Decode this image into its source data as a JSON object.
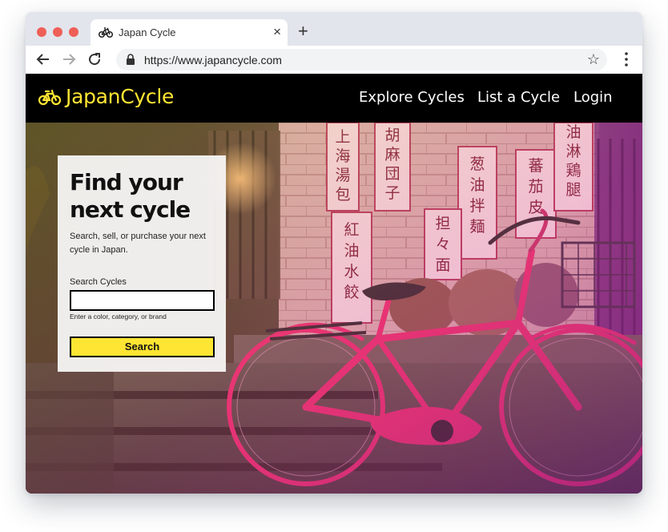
{
  "browser": {
    "tab_title": "Japan Cycle",
    "tab_close": "×",
    "new_tab": "+",
    "url": "https://www.japancycle.com",
    "bookmark": "☆"
  },
  "site": {
    "brand": "JapanCycle",
    "nav": [
      "Explore Cycles",
      "List a Cycle",
      "Login"
    ]
  },
  "hero": {
    "signs": [
      "上海湯包",
      "胡麻団子",
      "葱油拌麺",
      "蕃茄皮",
      "油淋鶏腿",
      "紅油水餃",
      "担々面"
    ]
  },
  "card": {
    "title_line1": "Find your",
    "title_line2": "next cycle",
    "description": "Search, sell, or purchase your next cycle in Japan.",
    "search_label": "Search Cycles",
    "search_value": "",
    "search_hint": "Enter a color, category, or brand",
    "search_button": "Search"
  },
  "colors": {
    "accent": "#ffe533",
    "header_bg": "#000000",
    "bike_pink": "#e8306e",
    "overlay_purple": "#7a1b85"
  }
}
